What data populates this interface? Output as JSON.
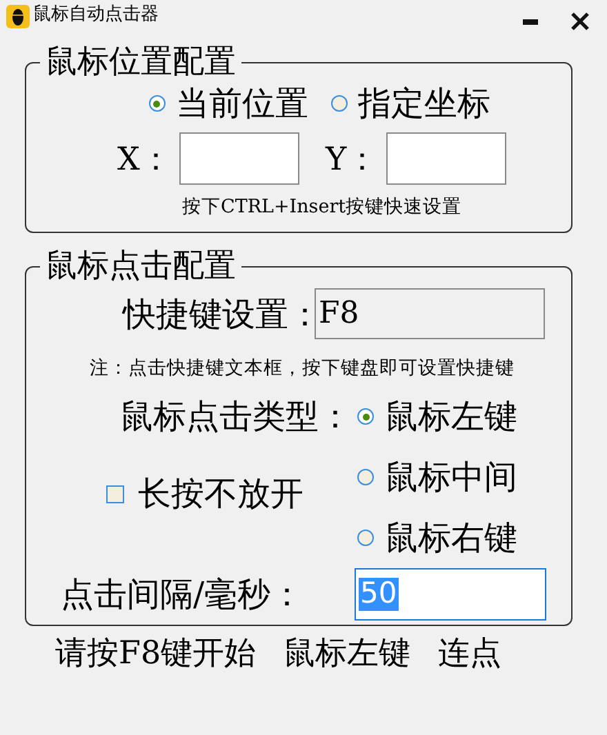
{
  "window": {
    "title": "鼠标自动点击器"
  },
  "position_group": {
    "title": "鼠标位置配置",
    "modes": [
      {
        "label": "当前位置",
        "selected": true
      },
      {
        "label": "指定坐标",
        "selected": false
      }
    ],
    "x_label": "X：",
    "y_label": "Y：",
    "hint": "按下CTRL+Insert按键快速设置"
  },
  "click_group": {
    "title": "鼠标点击配置",
    "hotkey_label": "快捷键设置：",
    "hotkey_value": "F8",
    "note": "注：点击快捷键文本框，按下键盘即可设置快捷键",
    "type_label": "鼠标点击类型：",
    "types": [
      {
        "label": "鼠标左键",
        "selected": true
      },
      {
        "label": "鼠标中间",
        "selected": false
      },
      {
        "label": "鼠标右键",
        "selected": false
      }
    ],
    "hold": {
      "label": "长按不放开",
      "checked": false
    },
    "interval_label": "点击间隔/毫秒：",
    "interval_value": "50",
    "interval_focused": true
  },
  "status": [
    "请按F8键开始",
    "鼠标左键",
    "连点"
  ]
}
